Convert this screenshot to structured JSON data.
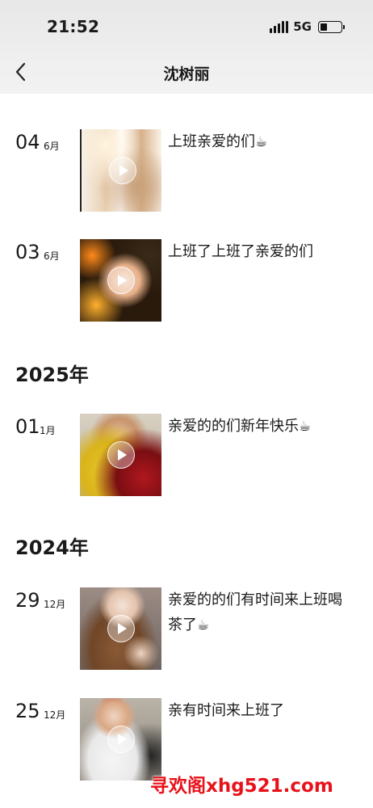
{
  "status": {
    "time": "21:52",
    "network": "5G",
    "battery_level": 0.35
  },
  "nav": {
    "title": "沈树丽"
  },
  "feed": {
    "posts": [
      {
        "day": "04",
        "month": "6月",
        "caption": "上班亲爱的们",
        "emoji": "☕"
      },
      {
        "day": "03",
        "month": "6月",
        "caption": "上班了上班了亲爱的们",
        "emoji": ""
      },
      {
        "day": "01",
        "month": "1月",
        "caption": "亲爱的的们新年快乐",
        "emoji": "☕"
      },
      {
        "day": "29",
        "month": "12月",
        "caption": "亲爱的的们有时间来上班喝茶了",
        "emoji": "☕"
      },
      {
        "day": "25",
        "month": "12月",
        "caption": "亲有时间来上班了",
        "emoji": ""
      }
    ],
    "years": [
      "2025年",
      "2024年"
    ]
  },
  "icons": {
    "back": "chevron-left-icon",
    "play": "play-icon",
    "signal": "signal-icon",
    "battery": "battery-icon"
  },
  "watermark": "寻欢阁xhg521.com"
}
